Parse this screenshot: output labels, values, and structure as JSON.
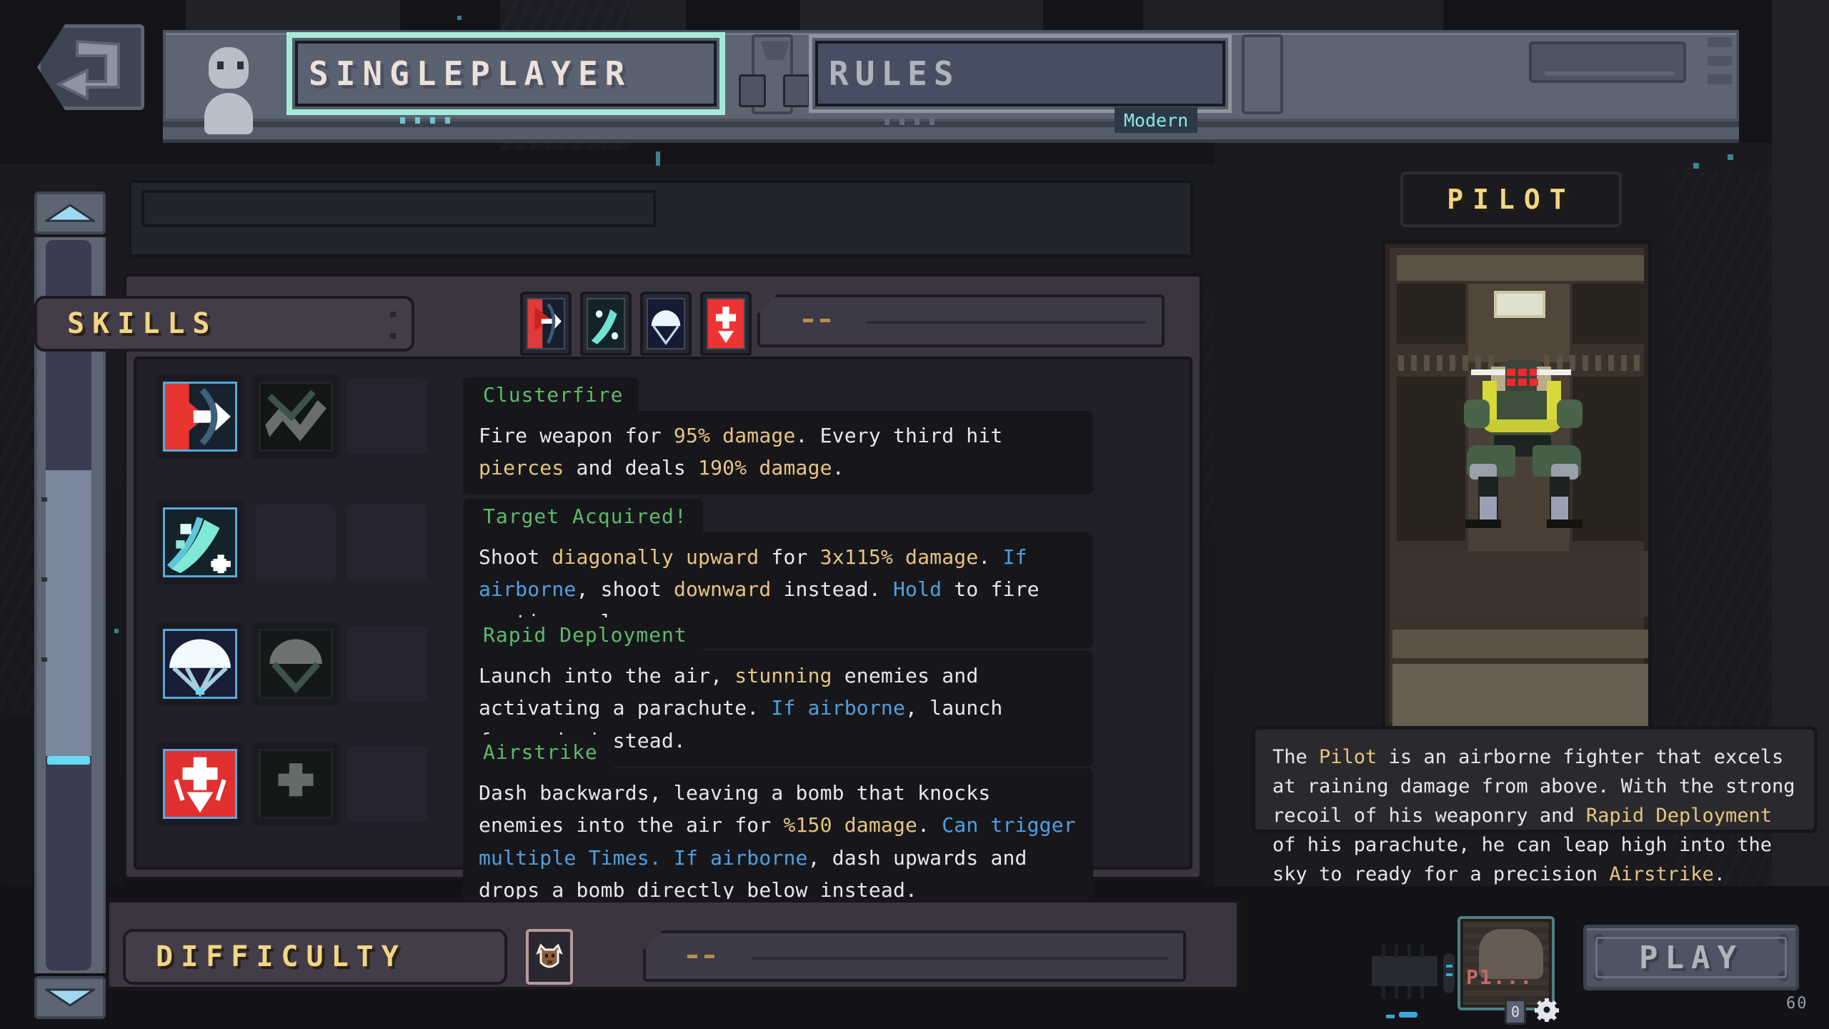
{
  "window": {
    "fps": "60"
  },
  "topbar": {
    "back_icon": "back-arrow-icon",
    "avatar_icon": "player-avatar-icon",
    "tabs": [
      {
        "id": "singleplayer",
        "label": "SINGLEPLAYER",
        "active": true
      },
      {
        "id": "rules",
        "label": "RULES",
        "active": false
      }
    ],
    "ruleset_badge": "Modern"
  },
  "scrollbar": {
    "up_icon": "chevron-up-icon",
    "down_icon": "chevron-down-icon"
  },
  "skills_section": {
    "header_label": "SKILLS",
    "tab_icons": [
      "clusterfire-icon",
      "target-acquired-icon",
      "rapid-deployment-icon",
      "airstrike-icon"
    ],
    "skills": [
      {
        "name": "Clusterfire",
        "icon": "clusterfire-icon",
        "alt_icon": "clusterfire-alt-icon",
        "description_parts": [
          {
            "t": "Fire weapon for ",
            "c": "w"
          },
          {
            "t": "95% damage",
            "c": "g"
          },
          {
            "t": ". Every third hit ",
            "c": "w"
          },
          {
            "t": "pierces",
            "c": "g"
          },
          {
            "t": " and deals ",
            "c": "w"
          },
          {
            "t": "190% damage",
            "c": "g"
          },
          {
            "t": ".",
            "c": "w"
          }
        ]
      },
      {
        "name": "Target Acquired!",
        "icon": "target-acquired-icon",
        "alt_icon": null,
        "description_parts": [
          {
            "t": "Shoot ",
            "c": "w"
          },
          {
            "t": "diagonally upward",
            "c": "g"
          },
          {
            "t": " for ",
            "c": "w"
          },
          {
            "t": "3x115% damage",
            "c": "g"
          },
          {
            "t": ". ",
            "c": "w"
          },
          {
            "t": "If airborne",
            "c": "b"
          },
          {
            "t": ", shoot ",
            "c": "w"
          },
          {
            "t": "downward",
            "c": "g"
          },
          {
            "t": " instead. ",
            "c": "w"
          },
          {
            "t": "Hold",
            "c": "b"
          },
          {
            "t": " to fire continuously.",
            "c": "w"
          }
        ]
      },
      {
        "name": "Rapid Deployment",
        "icon": "rapid-deployment-icon",
        "alt_icon": "rapid-deployment-alt-icon",
        "description_parts": [
          {
            "t": "Launch into the air, ",
            "c": "w"
          },
          {
            "t": "stunning",
            "c": "g"
          },
          {
            "t": " enemies and activating a parachute. ",
            "c": "w"
          },
          {
            "t": "If airborne",
            "c": "b"
          },
          {
            "t": ", launch forwards instead.",
            "c": "w"
          }
        ]
      },
      {
        "name": "Airstrike",
        "icon": "airstrike-icon",
        "alt_icon": "airstrike-alt-icon",
        "description_parts": [
          {
            "t": "Dash backwards, leaving a bomb that knocks enemies into the air for ",
            "c": "w"
          },
          {
            "t": "%150 damage",
            "c": "g"
          },
          {
            "t": ". ",
            "c": "w"
          },
          {
            "t": "Can trigger multiple Times.",
            "c": "b"
          },
          {
            "t": " ",
            "c": "w"
          },
          {
            "t": "If airborne",
            "c": "b"
          },
          {
            "t": ", dash upwards and drops a bomb directly below instead.",
            "c": "w"
          }
        ]
      }
    ]
  },
  "character_panel": {
    "title": "PILOT",
    "portrait_icon": "pilot-portrait",
    "description_parts": [
      {
        "t": "The ",
        "c": "w"
      },
      {
        "t": "Pilot",
        "c": "g"
      },
      {
        "t": " is an airborne fighter that excels at raining damage from above. With the strong recoil of his weaponry and ",
        "c": "w"
      },
      {
        "t": "Rapid Deployment",
        "c": "g"
      },
      {
        "t": " of his parachute, he can leap high into the sky to ready for a precision ",
        "c": "w"
      },
      {
        "t": "Airstrike",
        "c": "g"
      },
      {
        "t": ".",
        "c": "w"
      }
    ]
  },
  "bottom_bar": {
    "difficulty_label": "DIFFICULTY",
    "difficulty_icon": "beast-head-icon",
    "play_label": "PLAY",
    "player_slot_label": "P1...",
    "settings_icon": "gear-icon",
    "keyboard_icon": "key-slot-icon"
  },
  "colors": {
    "accent_cyan": "#a4ead9",
    "gold": "#f2d684",
    "skill_title_green": "#5db96b",
    "highlight_gold": "#e8c57e",
    "highlight_blue": "#4fa0e0",
    "panel_bg": "#3a3540",
    "dark_bg": "#17171b"
  }
}
